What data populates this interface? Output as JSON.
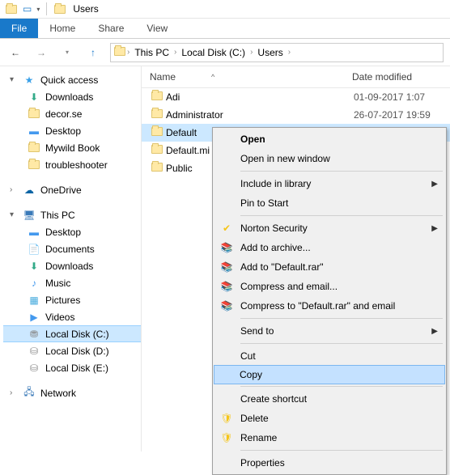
{
  "title": "Users",
  "ribbon": {
    "file": "File",
    "home": "Home",
    "share": "Share",
    "view": "View"
  },
  "breadcrumb": [
    "This PC",
    "Local Disk (C:)",
    "Users"
  ],
  "columns": {
    "name": "Name",
    "date": "Date modified"
  },
  "tree": {
    "quick": "Quick access",
    "quick_items": [
      "Downloads",
      "decor.se",
      "Desktop",
      "Mywild Book",
      "troubleshooter"
    ],
    "onedrive": "OneDrive",
    "thispc": "This PC",
    "pc_items": [
      "Desktop",
      "Documents",
      "Downloads",
      "Music",
      "Pictures",
      "Videos",
      "Local Disk (C:)",
      "Local Disk (D:)",
      "Local Disk (E:)"
    ],
    "network": "Network"
  },
  "rows": [
    {
      "name": "Adi",
      "date": "01-09-2017 1:07"
    },
    {
      "name": "Administrator",
      "date": "26-07-2017 19:59"
    },
    {
      "name": "Default",
      "date": ""
    },
    {
      "name": "Default.mi",
      "date": ""
    },
    {
      "name": "Public",
      "date": ""
    }
  ],
  "ctx": {
    "open": "Open",
    "open_new": "Open in new window",
    "include": "Include in library",
    "pin": "Pin to Start",
    "norton": "Norton Security",
    "add_archive": "Add to archive...",
    "add_default": "Add to \"Default.rar\"",
    "compress_email": "Compress and email...",
    "compress_default": "Compress to \"Default.rar\" and email",
    "send": "Send to",
    "cut": "Cut",
    "copy": "Copy",
    "shortcut": "Create shortcut",
    "delete": "Delete",
    "rename": "Rename",
    "properties": "Properties"
  }
}
